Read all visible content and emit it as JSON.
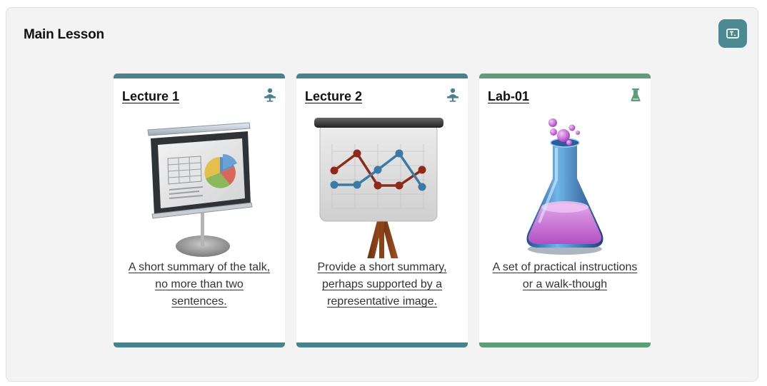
{
  "panel": {
    "title": "Main Lesson",
    "corner_button_icon": "text-box-icon"
  },
  "cards": [
    {
      "title": "Lecture 1",
      "type_icon": "presenter-icon",
      "image": "projector-screen-pie-chart-image",
      "summary": "A short summary of the talk, no more than two sentences."
    },
    {
      "title": "Lecture 2",
      "type_icon": "presenter-icon",
      "image": "easel-line-chart-image",
      "summary": "Provide a short summary, perhaps supported by a representative image."
    },
    {
      "title": "Lab-01",
      "type_icon": "flask-icon",
      "image": "chemistry-flask-image",
      "summary": "A set of practical instructions or a walk-though"
    }
  ],
  "colors": {
    "lecture_accent": "#4a828c",
    "lab_accent": "#5c9e78",
    "corner_button": "#4c8a93",
    "panel_background": "#f3f3f3"
  }
}
